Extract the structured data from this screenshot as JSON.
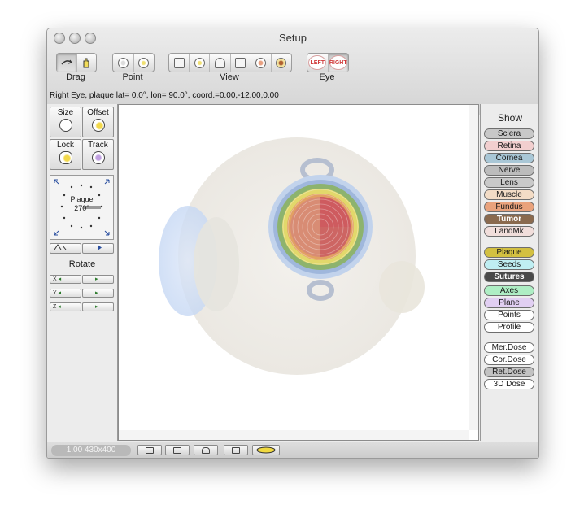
{
  "window": {
    "title": "Setup"
  },
  "toolbar": {
    "groups": [
      {
        "label": "Drag"
      },
      {
        "label": "Point"
      },
      {
        "label": "View"
      },
      {
        "label": "Eye"
      }
    ],
    "eye_left": "LEFT",
    "eye_right": "RIGHT"
  },
  "status": {
    "text": "Right Eye, plaque lat=  0.0°, lon= 90.0°, coord.=0.00,-12.00,0.00"
  },
  "left_panel": {
    "size_label": "Size",
    "offset_label": "Offset",
    "lock_label": "Lock",
    "track_label": "Track",
    "plaque_label": "Plaque",
    "plaque_angle": "270°",
    "rotate_label": "Rotate",
    "axes": [
      "X",
      "Y",
      "Z"
    ]
  },
  "show_panel": {
    "title": "Show",
    "groups": [
      [
        {
          "label": "Sclera",
          "color": "#c8c8c8"
        },
        {
          "label": "Retina",
          "color": "#f2cfcf"
        },
        {
          "label": "Cornea",
          "color": "#a9c7d6"
        },
        {
          "label": "Nerve",
          "color": "#bcbcbc"
        },
        {
          "label": "Lens",
          "color": "#c9c9c9"
        },
        {
          "label": "Muscle",
          "color": "#f3dcc6"
        },
        {
          "label": "Fundus",
          "color": "#e9a27c"
        },
        {
          "label": "Tumor",
          "color": "#8a6a4e"
        },
        {
          "label": "LandMk",
          "color": "#f1dedb"
        }
      ],
      [
        {
          "label": "Plaque",
          "color": "#d3c041"
        },
        {
          "label": "Seeds",
          "color": "#bfeef2"
        },
        {
          "label": "Sutures",
          "color": "#4a4a4a"
        }
      ],
      [
        {
          "label": "Axes",
          "color": "#aeeec4"
        },
        {
          "label": "Plane",
          "color": "#e1cff2"
        },
        {
          "label": "Points",
          "color": "#ffffff"
        },
        {
          "label": "Profile",
          "color": "#ffffff"
        }
      ],
      [
        {
          "label": "Mer.Dose",
          "color": "#ffffff"
        },
        {
          "label": "Cor.Dose",
          "color": "#ffffff"
        },
        {
          "label": "Ret.Dose",
          "color": "#c2c2c2"
        },
        {
          "label": "3D Dose",
          "color": "#ffffff"
        }
      ]
    ]
  },
  "bottom_bar": {
    "zoom_text": "1.00 430x400"
  }
}
